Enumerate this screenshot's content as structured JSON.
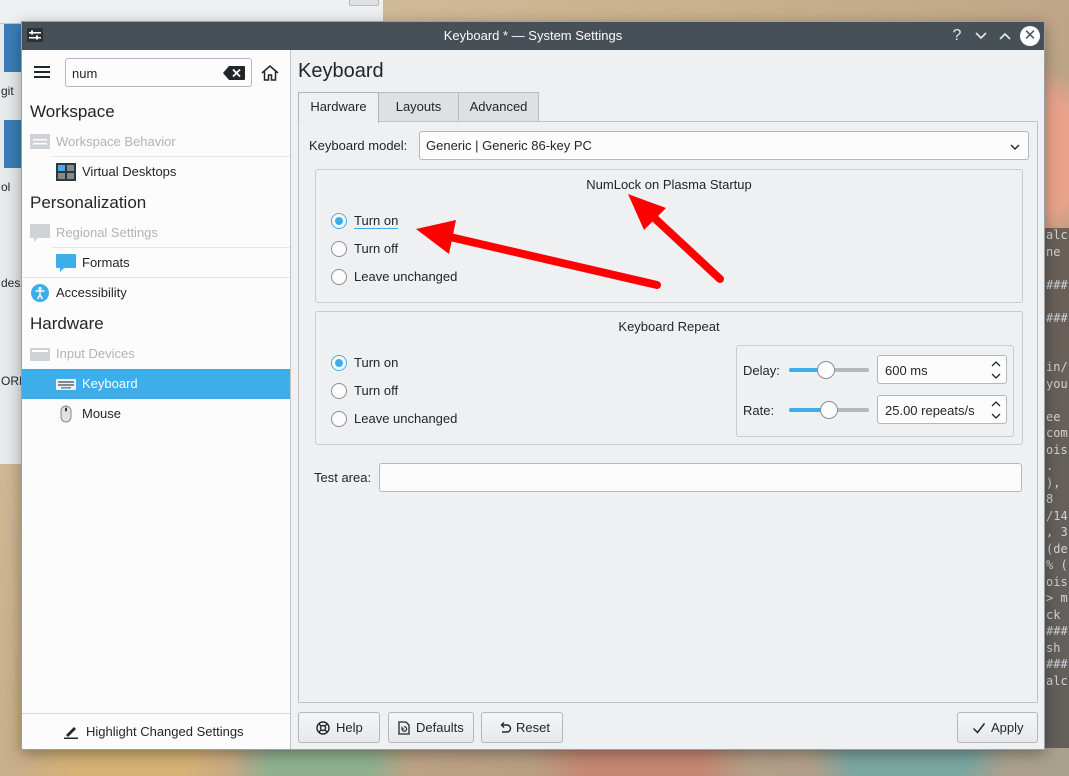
{
  "window": {
    "title": "Keyboard * — System Settings"
  },
  "background": {
    "left_labels": [
      "git",
      "ol",
      "des",
      "ORIG"
    ],
    "terminal_lines": [
      "alc",
      "ne",
      "",
      "###",
      "",
      "###",
      "",
      "",
      "in/",
      "you",
      "",
      "ee",
      "com",
      "ois",
      ".",
      "),",
      " 8",
      "/14",
      ", 3",
      "(de",
      "% (",
      "ois",
      "> m",
      "ck",
      "###",
      "sh",
      "###",
      "alc"
    ]
  },
  "sidebar": {
    "search_value": "num",
    "groups": {
      "workspace": "Workspace",
      "personalization": "Personalization",
      "hardware": "Hardware"
    },
    "items": {
      "workspace_behavior": "Workspace Behavior",
      "virtual_desktops": "Virtual Desktops",
      "regional_settings": "Regional Settings",
      "formats": "Formats",
      "accessibility": "Accessibility",
      "input_devices": "Input Devices",
      "keyboard": "Keyboard",
      "mouse": "Mouse"
    },
    "highlight_changed": "Highlight Changed Settings"
  },
  "content": {
    "title": "Keyboard",
    "tabs": [
      "Hardware",
      "Layouts",
      "Advanced"
    ],
    "active_tab": "Hardware",
    "keyboard_model_label": "Keyboard model:",
    "keyboard_model_value": "Generic | Generic 86-key PC",
    "numlock": {
      "title": "NumLock on Plasma Startup",
      "options": [
        "Turn on",
        "Turn off",
        "Leave unchanged"
      ],
      "selected": "Turn on"
    },
    "repeat": {
      "title": "Keyboard Repeat",
      "options": [
        "Turn on",
        "Turn off",
        "Leave unchanged"
      ],
      "selected": "Turn on",
      "delay_label": "Delay:",
      "delay_value": "600 ms",
      "delay_level": 0.45,
      "rate_label": "Rate:",
      "rate_value": "25.00 repeats/s",
      "rate_level": 0.5
    },
    "test_area_label": "Test area:",
    "test_area_value": ""
  },
  "footer": {
    "help": "Help",
    "defaults": "Defaults",
    "reset": "Reset",
    "apply": "Apply"
  },
  "colors": {
    "accent": "#3daee9",
    "titlebar": "#475057",
    "annotation_arrow": "#ff0000"
  }
}
